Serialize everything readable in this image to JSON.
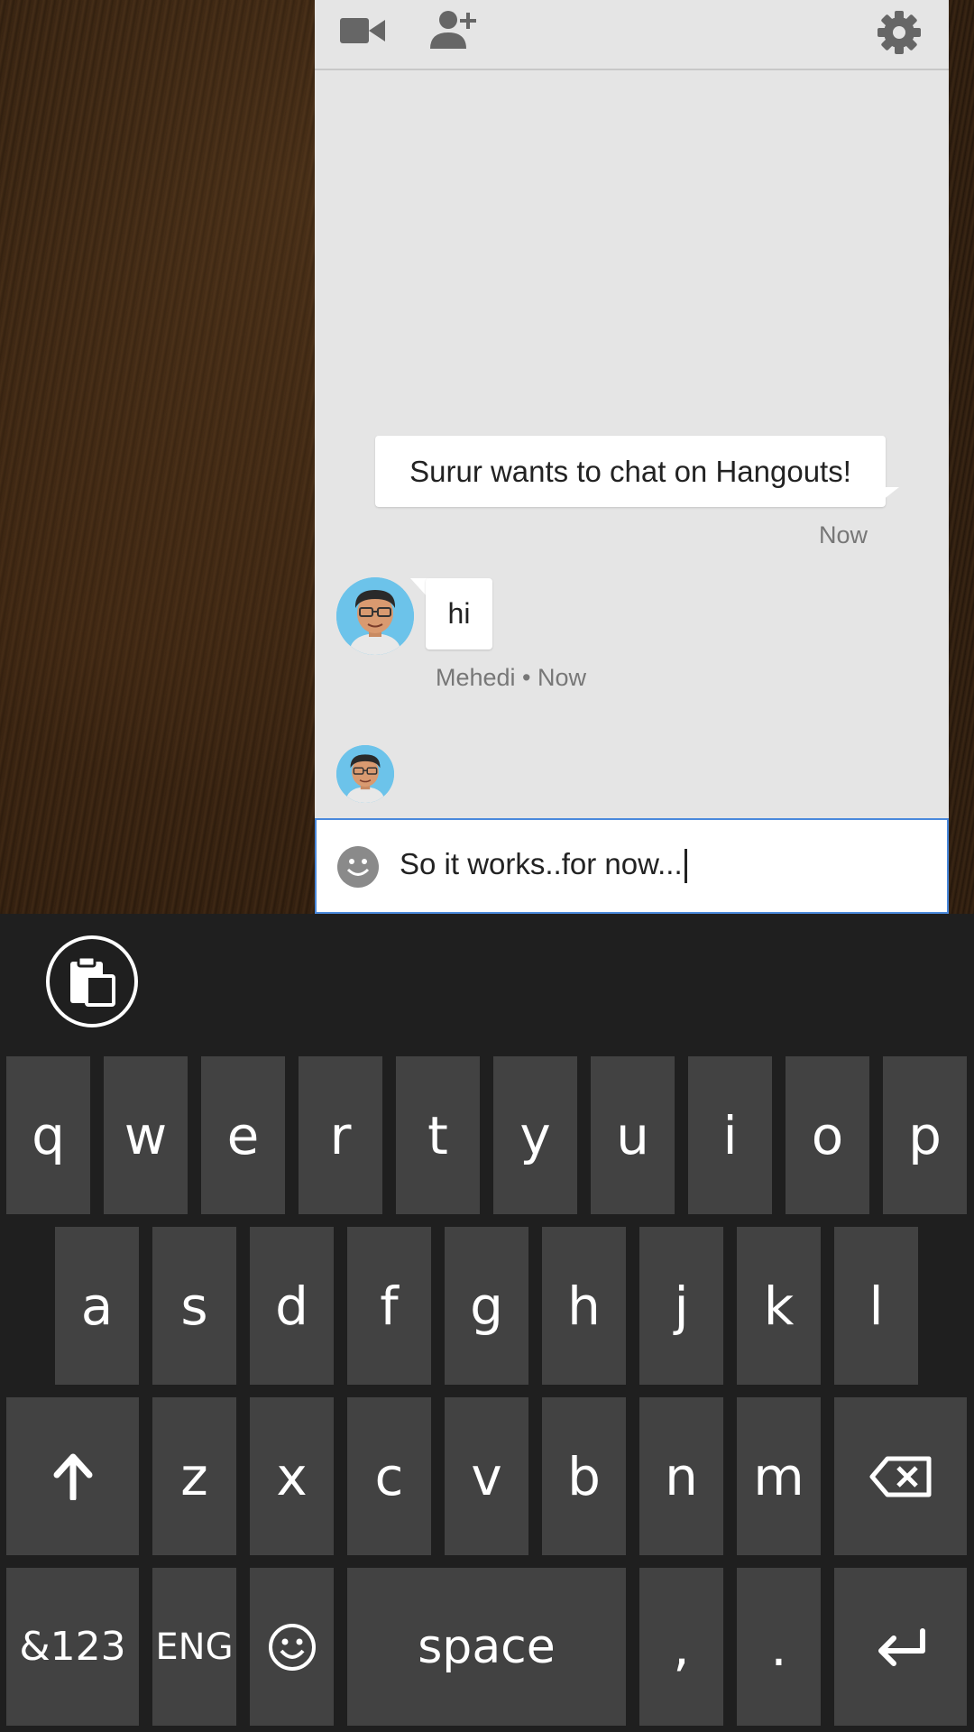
{
  "toolbar": {
    "video_icon": "video-camera-icon",
    "add_person_icon": "add-person-icon",
    "settings_icon": "gear-icon"
  },
  "messages": {
    "system_text": "Surur wants to chat on Hangouts!",
    "system_time": "Now",
    "hi_text": "hi",
    "hi_meta": "Mehedi • Now"
  },
  "composer": {
    "value": "So it works..for now...",
    "emoji_icon": "smiley-icon"
  },
  "keyboard": {
    "clipboard_icon": "clipboard-icon",
    "row1": [
      "q",
      "w",
      "e",
      "r",
      "t",
      "y",
      "u",
      "i",
      "o",
      "p"
    ],
    "row2": [
      "a",
      "s",
      "d",
      "f",
      "g",
      "h",
      "j",
      "k",
      "l"
    ],
    "row3": [
      "z",
      "x",
      "c",
      "v",
      "b",
      "n",
      "m"
    ],
    "shift_icon": "shift-arrow-icon",
    "backspace_icon": "backspace-icon",
    "symbols_label": "&123",
    "lang_label": "ENG",
    "emoji_key_icon": "emoji-icon",
    "space_label": "space",
    "comma_label": ",",
    "period_label": ".",
    "enter_icon": "enter-icon"
  },
  "colors": {
    "accent": "#4a89dc",
    "key": "#424242",
    "keyboard_bg": "#1f1f1f",
    "panel_bg": "#e5e5e5"
  }
}
